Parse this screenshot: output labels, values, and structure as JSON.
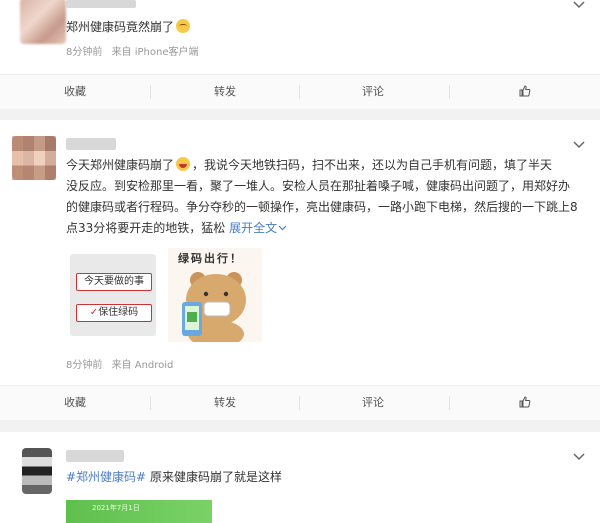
{
  "posts": [
    {
      "text": "郑州健康码竟然崩了",
      "time": "8分钟前",
      "source": "来自 iPhone客户端",
      "actions": {
        "favorite": "收藏",
        "repost": "转发",
        "comment": "评论"
      }
    },
    {
      "text_part1": "今天郑州健康码崩了",
      "text_part2": "，我说今天地铁扫码，扫不出来，还以为自己手机有问题，填了半天",
      "text_line2": "没反应。到安检那里一看，聚了一堆人。安检人员在那扯着嗓子喊，健康码出问题了，用郑好办",
      "text_line3": "的健康码或者行程码。争分夺秒的一顿操作，亮出健康码，一路小跑下电梯，然后搜的一下跳上8",
      "text_line4": "点33分将要开走的地铁，猛松",
      "expand": "展开全文",
      "image1_line1": "今天要做的事",
      "image1_line2": "保住绿码",
      "image2_caption": "绿码出行！",
      "time": "8分钟前",
      "source": "来自 Android",
      "actions": {
        "favorite": "收藏",
        "repost": "转发",
        "comment": "评论"
      }
    },
    {
      "hashtag": "#郑州健康码#",
      "text": "原来健康码崩了就是这样",
      "image_caption": "2021年7月1日"
    }
  ],
  "icons": {
    "chevron": "chevron-down-icon",
    "like": "thumbs-up-icon",
    "expand": "chevron-down-icon"
  },
  "colors": {
    "link": "#4a7cc7",
    "green_code": "#5fbf4d"
  }
}
